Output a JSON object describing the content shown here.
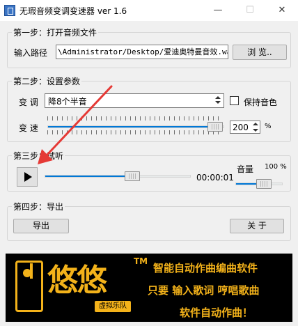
{
  "window": {
    "title": "无瑕音频变调变速器 ver 1.6",
    "minimize": "—",
    "maximize": "☐",
    "close": "✕"
  },
  "step1": {
    "legend": "第一步：打开音频文件",
    "path_label": "输入路径",
    "path_value": "\\Administrator/Desktop/爱迪奥特曼音效.wav",
    "browse_label": "浏  览.."
  },
  "step2": {
    "legend": "第二步：设置参数",
    "pitch_label": "变 调",
    "pitch_selected": "降8个半音",
    "keep_timbre_label": "保持音色",
    "keep_timbre_checked": false,
    "speed_label": "变 速",
    "speed_value": "200",
    "speed_unit": "%",
    "speed_slider_fraction": 0.95
  },
  "step3": {
    "legend": "第三步：试听",
    "time": "00:00:01",
    "progress_fraction": 0.6,
    "volume_label": "音量",
    "volume_value": "100 %",
    "volume_fraction": 0.6
  },
  "step4": {
    "legend": "第四步：导出",
    "export_label": "导出",
    "about_label": "关  于"
  },
  "ad": {
    "logo_text": "悠悠",
    "logo_tm": "TM",
    "logo_sub": "虚拟乐队",
    "line1": "智能自动作曲编曲软件",
    "line2": "只要 输入歌词  哼唱歌曲",
    "line3": "软件自动作曲！"
  },
  "colors": {
    "accent": "#0078d7",
    "annotation_arrow": "#e53935",
    "ad_text": "#f3b21a"
  }
}
